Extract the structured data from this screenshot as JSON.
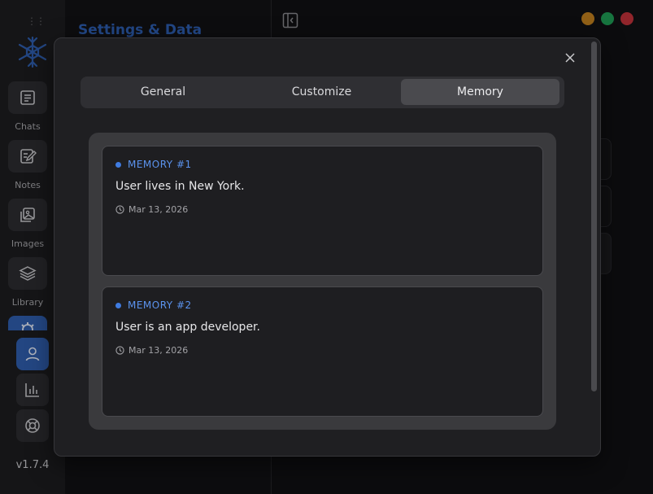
{
  "sidebar": {
    "items": [
      {
        "label": "Chats",
        "icon": "chat-icon"
      },
      {
        "label": "Notes",
        "icon": "notes-icon"
      },
      {
        "label": "Images",
        "icon": "images-icon"
      },
      {
        "label": "Library",
        "icon": "library-icon"
      }
    ],
    "version": "v1.7.4"
  },
  "background": {
    "title": "Settings & Data"
  },
  "window_controls": {
    "colors": [
      "#c2811f",
      "#1f9c55",
      "#c2323a"
    ]
  },
  "modal": {
    "tabs": [
      {
        "label": "General",
        "active": false
      },
      {
        "label": "Customize",
        "active": false
      },
      {
        "label": "Memory",
        "active": true
      }
    ],
    "memories": [
      {
        "title": "MEMORY #1",
        "text": "User lives in New York.",
        "date": "Mar 13, 2026"
      },
      {
        "title": "MEMORY #2",
        "text": "User is an app developer.",
        "date": "Mar 13, 2026"
      }
    ]
  },
  "colors": {
    "accent": "#2f5eae",
    "memory_label": "#5b93ee"
  }
}
